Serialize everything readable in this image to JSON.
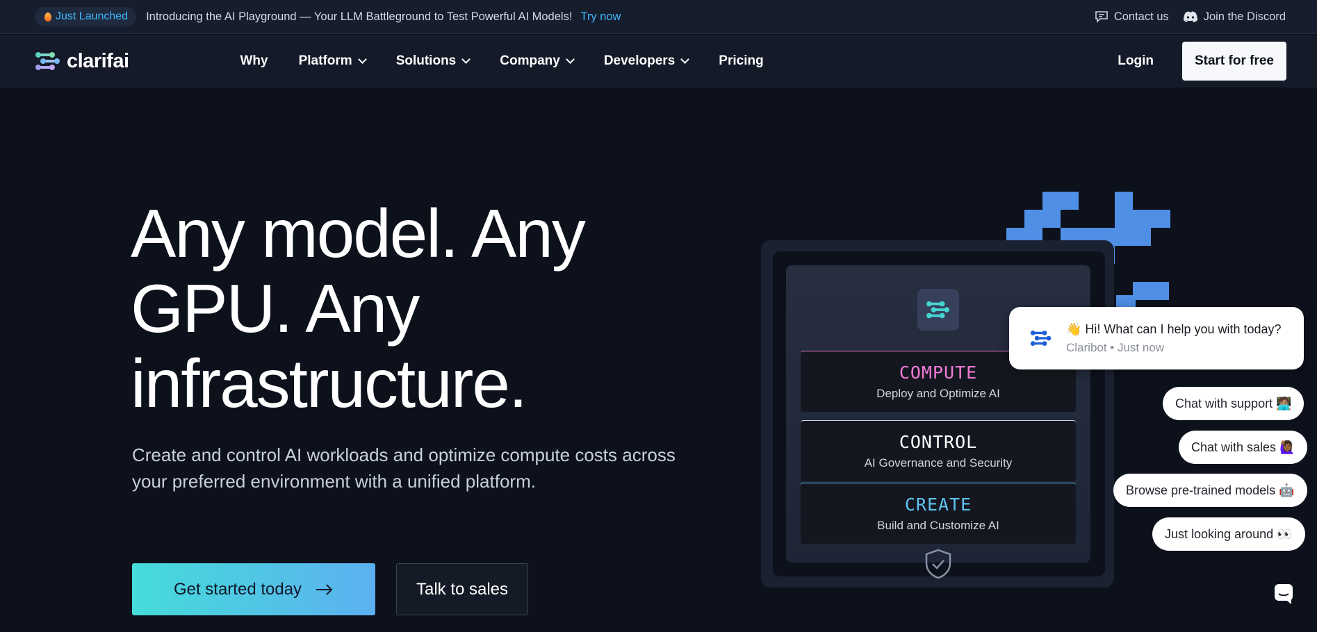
{
  "announcement": {
    "badge": "Just Launched",
    "text": "Introducing the AI Playground — Your LLM Battleground to Test Powerful AI Models!",
    "link": "Try now",
    "contact": "Contact us",
    "discord": "Join the Discord"
  },
  "nav": {
    "brand": "clarifai",
    "items": [
      "Why",
      "Platform",
      "Solutions",
      "Company",
      "Developers",
      "Pricing"
    ],
    "login": "Login",
    "cta": "Start for free"
  },
  "hero": {
    "headline_line1": "Any model. Any",
    "headline_line2": "GPU. Any",
    "headline_line3": "infrastructure.",
    "subtitle_line1": "Create and control AI workloads and optimize compute costs across",
    "subtitle_line2": "your preferred environment with a unified platform.",
    "cta_primary": "Get started today",
    "cta_secondary": "Talk to sales"
  },
  "graphic": {
    "cards": [
      {
        "title": "COMPUTE",
        "subtitle": "Deploy and Optimize AI",
        "color": "#f07bd6"
      },
      {
        "title": "CONTROL",
        "subtitle": "AI Governance and Security",
        "color": "#ffffff"
      },
      {
        "title": "CREATE",
        "subtitle": "Build and Customize AI",
        "color": "#5fc4f2"
      }
    ]
  },
  "chat": {
    "greeting": "👋 Hi! What can I help you with today?",
    "meta": "Claribot • Just now",
    "replies": [
      "Chat with support 🧑🏽‍💻",
      "Chat with sales 🙋🏾‍♀️",
      "Browse pre-trained models 🤖",
      "Just looking around 👀"
    ]
  },
  "colors": {
    "accent": "#3fb7ff",
    "cta_gradient_start": "#45dcd9",
    "cta_gradient_end": "#5cb0f0",
    "background": "#0d111c"
  },
  "icons": {
    "flame": "flame-icon",
    "contact": "chat-bubble-icon",
    "discord": "discord-icon",
    "arrow": "arrow-right-icon",
    "shield": "shield-check-icon",
    "launcher": "chat-launcher-icon"
  }
}
